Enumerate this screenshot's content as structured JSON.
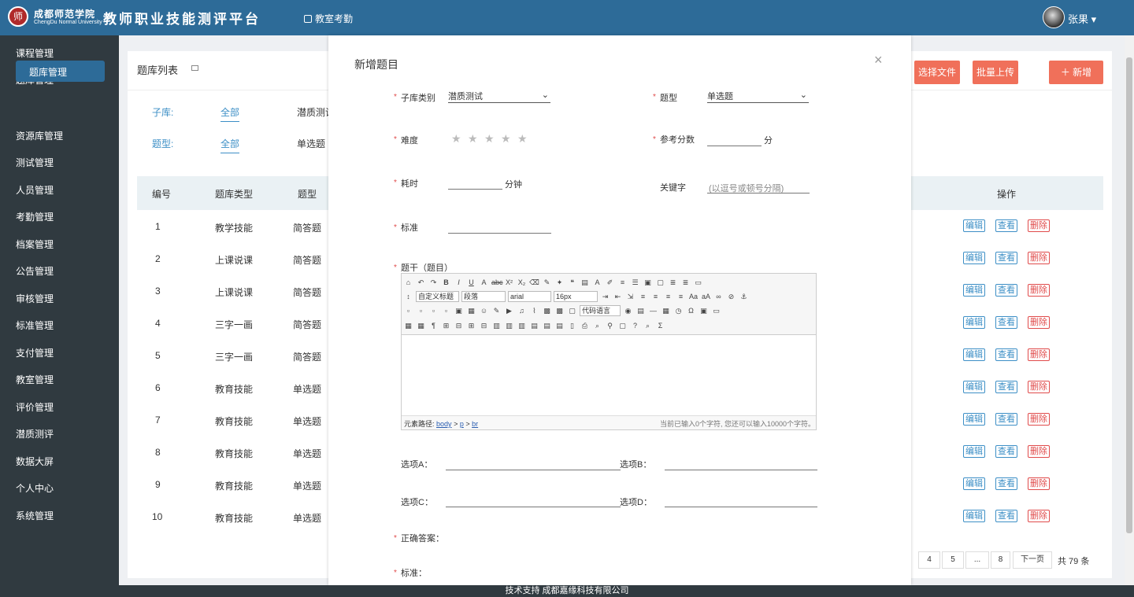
{
  "header": {
    "logo_char": "师",
    "school_cn": "成都师范学院",
    "school_en": "ChengDu Normal University",
    "platform": "教师职业技能测评平台",
    "nav": "教室考勤",
    "user": "张果 ▾"
  },
  "sidebar": {
    "items": [
      "课程管理",
      "题库管理",
      "资源库管理",
      "测试管理",
      "人员管理",
      "考勤管理",
      "档案管理",
      "公告管理",
      "审核管理",
      "标准管理",
      "支付管理",
      "教室管理",
      "评价管理",
      "潜质测评",
      "数据大屏",
      "个人中心",
      "系统管理"
    ],
    "active": "题库管理"
  },
  "panel": {
    "title": "题库列表",
    "filter_sub_label": "子库:",
    "filter_sub_value": "全部",
    "filter_sub_opt": "潜质测试",
    "filter_type_label": "题型:",
    "filter_type_value": "全部",
    "filter_type_opt": "单选题",
    "buttons": {
      "choose_file": "选择文件",
      "batch_upload": "批量上传",
      "add": "＋  新增"
    },
    "columns": {
      "no": "编号",
      "type": "题库类型",
      "qtype": "题型",
      "op": "操作"
    },
    "rows": [
      [
        "1",
        "教学技能",
        "简答题"
      ],
      [
        "2",
        "上课说课",
        "简答题"
      ],
      [
        "3",
        "上课说课",
        "简答题"
      ],
      [
        "4",
        "三字一画",
        "简答题"
      ],
      [
        "5",
        "三字一画",
        "简答题"
      ],
      [
        "6",
        "教育技能",
        "单选题"
      ],
      [
        "7",
        "教育技能",
        "单选题"
      ],
      [
        "8",
        "教育技能",
        "单选题"
      ],
      [
        "9",
        "教育技能",
        "单选题"
      ],
      [
        "10",
        "教育技能",
        "单选题"
      ]
    ],
    "ops": {
      "edit": "编辑",
      "view": "查看",
      "del": "删除"
    },
    "pager": {
      "p4": "4",
      "p5": "5",
      "ellipsis": "...",
      "p8": "8",
      "next": "下一页",
      "total": "共 79 条"
    }
  },
  "modal": {
    "title": "新增题目",
    "close": "×",
    "sub_label": "子库类别",
    "sub_value": "潜质测试",
    "qtype_label": "题型",
    "qtype_value": "单选题",
    "difficulty_label": "难度",
    "stars": "★",
    "score_label": "参考分数",
    "score_unit": "分",
    "time_label": "耗时",
    "time_unit": "分钟",
    "keyword_label": "关键字",
    "keyword_placeholder": "(以逗号或顿号分隔)",
    "standard_label": "标准",
    "stem_label": "题干（题目）",
    "editor": {
      "font_style": "自定义标题",
      "para": "段落",
      "font": "arial",
      "size": "16px",
      "code": "代码语言",
      "path_label": "元素路径:",
      "path_body": "body",
      "path_p": "p",
      "path_br": "br",
      "count": "当前已输入0个字符, 您还可以输入10000个字符。"
    },
    "optA": "选项A：",
    "optB": "选项B：",
    "optC": "选项C：",
    "optD": "选项D：",
    "answer_label": "正确答案：",
    "standard2_label": "标准："
  },
  "footer": "技术支持 成都嘉缘科技有限公司"
}
